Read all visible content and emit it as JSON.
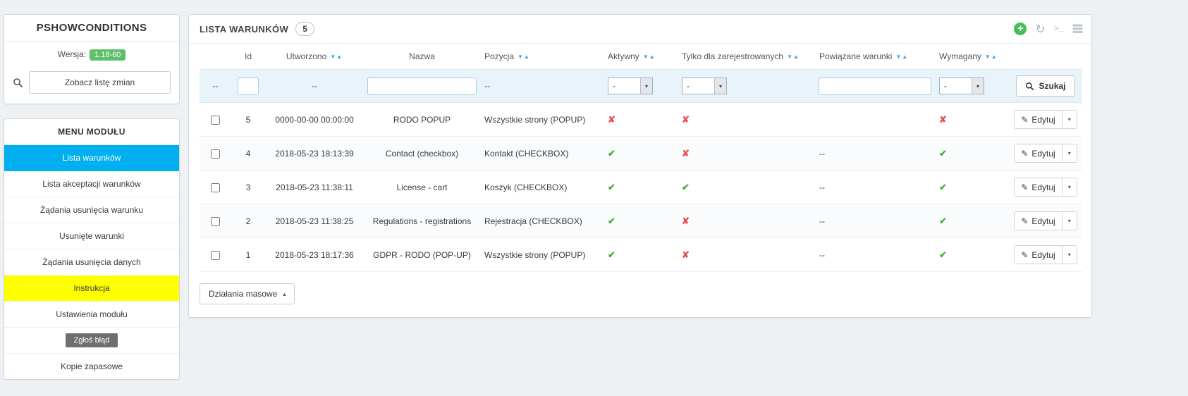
{
  "icons": {
    "plus": "+",
    "refresh": "↻",
    "terminal": ">_",
    "check": "✔",
    "cross": "✘",
    "pencil": "✎",
    "caret_down": "▾",
    "caret_up": "▴",
    "sort": "▼▲"
  },
  "sidebar": {
    "module_panel": {
      "title": "PSHOWCONDITIONS",
      "version_label": "Wersja:",
      "version_value": "1.18-60",
      "changelog_label": "Zobacz listę zmian"
    },
    "menu_panel": {
      "title": "MENU MODUŁU",
      "items": [
        {
          "label": "Lista warunków",
          "style": "active"
        },
        {
          "label": "Lista akceptacji warunków",
          "style": "normal"
        },
        {
          "label": "Żądania usunięcia warunku",
          "style": "normal"
        },
        {
          "label": "Usunięte warunki",
          "style": "normal"
        },
        {
          "label": "Żądania usunięcia danych",
          "style": "normal"
        },
        {
          "label": "Instrukcja",
          "style": "highlight"
        },
        {
          "label": "Ustawienia modułu",
          "style": "normal"
        },
        {
          "label": "Zgłoś błąd",
          "style": "dark-badge"
        },
        {
          "label": "Kopie zapasowe",
          "style": "normal"
        }
      ]
    }
  },
  "main": {
    "header": {
      "title": "LISTA WARUNKÓW",
      "count": "5"
    },
    "table": {
      "columns": {
        "id": "Id",
        "created": "Utworzono",
        "name": "Nazwa",
        "position": "Pozycja",
        "active": "Aktywny",
        "registered": "Tylko dla zarejestrowanych",
        "related": "Powiązane warunki",
        "required": "Wymagany"
      },
      "filter": {
        "empty_marker": "--",
        "select_value": "-",
        "search_label": "Szukaj"
      },
      "edit_label": "Edytuj",
      "rows": [
        {
          "id": "5",
          "created": "0000-00-00 00:00:00",
          "name": "RODO POPUP",
          "position": "Wszystkie strony (POPUP)",
          "active": false,
          "registered": false,
          "related": "",
          "required": false
        },
        {
          "id": "4",
          "created": "2018-05-23 18:13:39",
          "name": "Contact (checkbox)",
          "position": "Kontakt (CHECKBOX)",
          "active": true,
          "registered": false,
          "related": "--",
          "required": true
        },
        {
          "id": "3",
          "created": "2018-05-23 11:38:11",
          "name": "License - cart",
          "position": "Koszyk (CHECKBOX)",
          "active": true,
          "registered": true,
          "related": "--",
          "required": true
        },
        {
          "id": "2",
          "created": "2018-05-23 11:38:25",
          "name": "Regulations - registrations",
          "position": "Rejestracja (CHECKBOX)",
          "active": true,
          "registered": false,
          "related": "--",
          "required": true
        },
        {
          "id": "1",
          "created": "2018-05-23 18:17:36",
          "name": "GDPR - RODO (POP-UP)",
          "position": "Wszystkie strony (POPUP)",
          "active": true,
          "registered": false,
          "related": "--",
          "required": true
        }
      ]
    },
    "bulk_actions_label": "Działania masowe"
  }
}
